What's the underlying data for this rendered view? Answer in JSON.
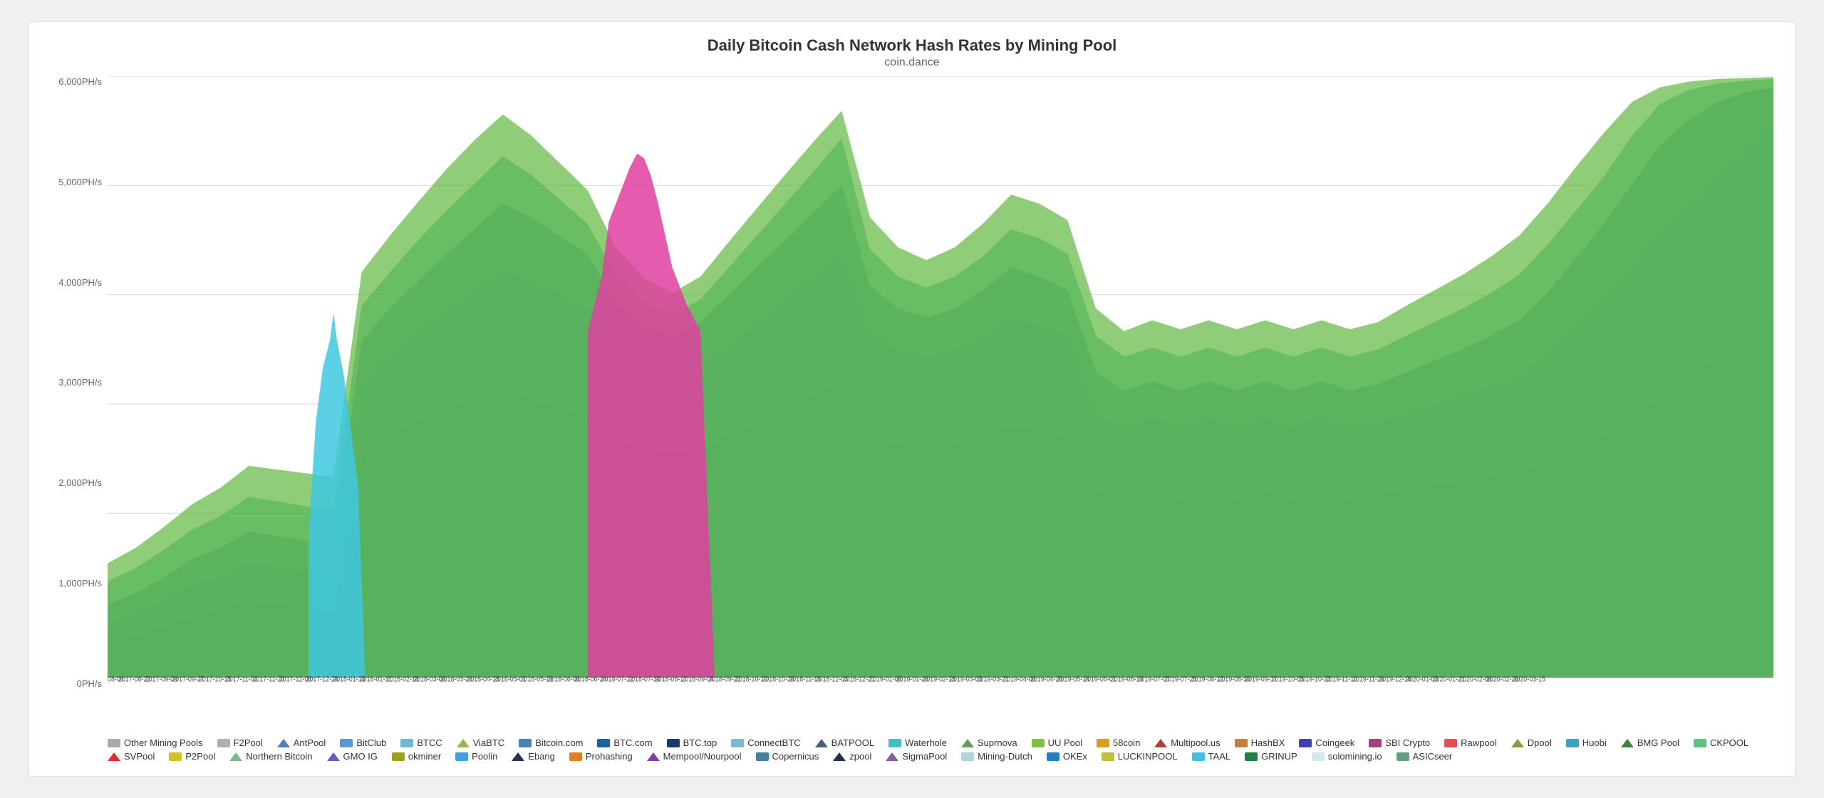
{
  "title": "Daily Bitcoin Cash Network Hash Rates by Mining Pool",
  "subtitle": "coin.dance",
  "yAxis": {
    "labels": [
      "6,000PH/s",
      "5,000PH/s",
      "4,000PH/s",
      "3,000PH/s",
      "2,000PH/s",
      "1,000PH/s",
      "0PH/s"
    ]
  },
  "legend": [
    {
      "label": "Other Mining Pools",
      "color": "#aaa",
      "type": "square"
    },
    {
      "label": "F2Pool",
      "color": "#b0b0b0",
      "type": "square"
    },
    {
      "label": "AntPool",
      "color": "#4a7fc1",
      "type": "triangle"
    },
    {
      "label": "BitClub",
      "color": "#5a9ad4",
      "type": "square"
    },
    {
      "label": "BTCC",
      "color": "#6dbad4",
      "type": "square"
    },
    {
      "label": "ViaBTC",
      "color": "#8fbc45",
      "type": "triangle"
    },
    {
      "label": "Bitcoin.com",
      "color": "#4682b4",
      "type": "square"
    },
    {
      "label": "BTC.com",
      "color": "#2060a0",
      "type": "square"
    },
    {
      "label": "BTC.top",
      "color": "#1a3a6e",
      "type": "square"
    },
    {
      "label": "ConnectBTC",
      "color": "#7ab8d4",
      "type": "square"
    },
    {
      "label": "BATPOOL",
      "color": "#4a6080",
      "type": "triangle"
    },
    {
      "label": "Waterhole",
      "color": "#40c0c0",
      "type": "square"
    },
    {
      "label": "Suprnova",
      "color": "#60a060",
      "type": "triangle"
    },
    {
      "label": "UU Pool",
      "color": "#80c040",
      "type": "square"
    },
    {
      "label": "58coin",
      "color": "#d4a020",
      "type": "square"
    },
    {
      "label": "Multipool.us",
      "color": "#b04040",
      "type": "triangle"
    },
    {
      "label": "HashBX",
      "color": "#c08040",
      "type": "square"
    },
    {
      "label": "Coingeek",
      "color": "#4040b0",
      "type": "square"
    },
    {
      "label": "SBI Crypto",
      "color": "#a04080",
      "type": "square"
    },
    {
      "label": "Rawpool",
      "color": "#e05050",
      "type": "square"
    },
    {
      "label": "Dpool",
      "color": "#80a040",
      "type": "triangle"
    },
    {
      "label": "Huobi",
      "color": "#40a0c0",
      "type": "square"
    },
    {
      "label": "BMG Pool",
      "color": "#408040",
      "type": "triangle"
    },
    {
      "label": "CKPOOL",
      "color": "#60c080",
      "type": "square"
    },
    {
      "label": "SVPool",
      "color": "#e03030",
      "type": "triangle"
    },
    {
      "label": "P2Pool",
      "color": "#d4c020",
      "type": "square"
    },
    {
      "label": "Northern Bitcoin",
      "color": "#7ab890",
      "type": "triangle"
    },
    {
      "label": "GMO IG",
      "color": "#6060c0",
      "type": "triangle"
    },
    {
      "label": "okminer",
      "color": "#a0a020",
      "type": "square"
    },
    {
      "label": "Poolin",
      "color": "#40a0e0",
      "type": "square"
    },
    {
      "label": "Ebang",
      "color": "#203060",
      "type": "triangle"
    },
    {
      "label": "Prohashing",
      "color": "#e08020",
      "type": "square"
    },
    {
      "label": "Mempool/Nourpool",
      "color": "#8040a0",
      "type": "triangle"
    },
    {
      "label": "Copernicus",
      "color": "#4080a0",
      "type": "square"
    },
    {
      "label": "zpool",
      "color": "#203050",
      "type": "triangle"
    },
    {
      "label": "SigmaPool",
      "color": "#8060a0",
      "type": "triangle"
    },
    {
      "label": "Mining-Dutch",
      "color": "#b0d4e0",
      "type": "square"
    },
    {
      "label": "OKEx",
      "color": "#2080c0",
      "type": "square"
    },
    {
      "label": "LUCKINPOOL",
      "color": "#c0c040",
      "type": "square"
    },
    {
      "label": "TAAL",
      "color": "#40c0e0",
      "type": "square"
    },
    {
      "label": "GRINUP",
      "color": "#208040",
      "type": "square"
    },
    {
      "label": "solomining.io",
      "color": "#d0e8f0",
      "type": "square"
    },
    {
      "label": "ASICseer",
      "color": "#60a080",
      "type": "square"
    }
  ]
}
